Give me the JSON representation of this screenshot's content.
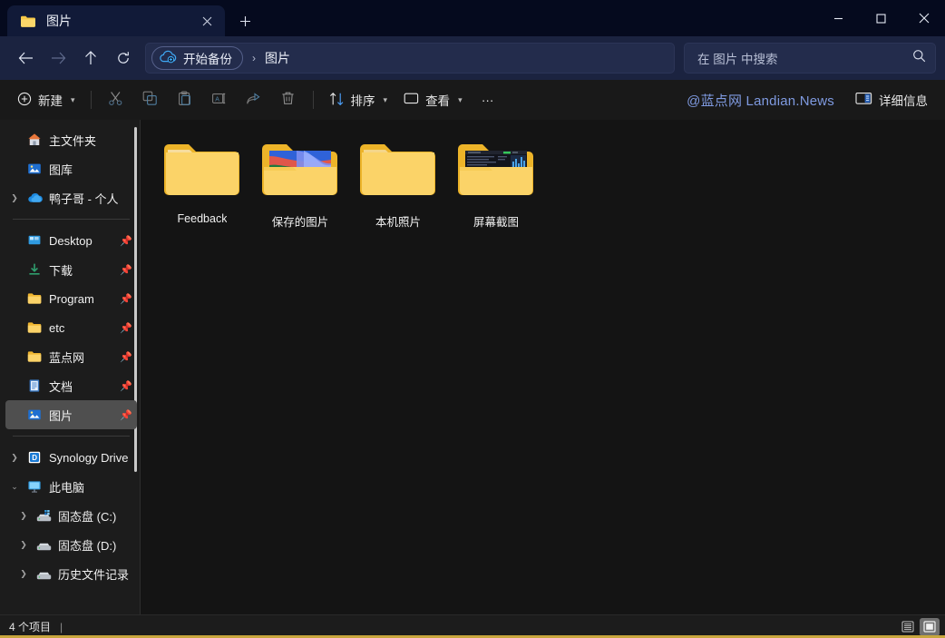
{
  "window": {
    "title": "图片",
    "controls": {
      "minimize": "minimize",
      "maximize": "maximize",
      "close": "close"
    }
  },
  "tabs": [
    {
      "title": "图片",
      "icon": "folder-icon",
      "close_label": "✕"
    }
  ],
  "newtab_label": "+",
  "address": {
    "back": "←",
    "forward": "→",
    "up": "↑",
    "refresh": "⟳",
    "backup_button": "开始备份",
    "separator": "›",
    "crumb": "图片"
  },
  "search": {
    "placeholder": "在 图片 中搜索",
    "icon": "search-icon"
  },
  "toolbar": {
    "new_label": "新建",
    "cut_label": "剪切",
    "copy_label": "复制",
    "paste_label": "粘贴",
    "rename_label": "重命名",
    "share_label": "共享",
    "delete_label": "删除",
    "sort_label": "排序",
    "view_label": "查看",
    "more_label": "···",
    "watermark": "@蓝点网 Landian.News",
    "details_label": "详细信息"
  },
  "sidebar": {
    "items": [
      {
        "label": "主文件夹",
        "icon": "home-icon",
        "chevron": false,
        "pinned": false,
        "selected": false
      },
      {
        "label": "图库",
        "icon": "gallery-icon",
        "chevron": false,
        "pinned": false,
        "selected": false
      },
      {
        "label": "鸭子哥 - 个人",
        "icon": "onedrive-icon",
        "chevron": true,
        "pinned": false,
        "selected": false
      }
    ],
    "pinned_items": [
      {
        "label": "Desktop",
        "icon": "desktop-icon",
        "chevron": false,
        "pinned": true,
        "selected": false
      },
      {
        "label": "下载",
        "icon": "downloads-icon",
        "chevron": false,
        "pinned": true,
        "selected": false
      },
      {
        "label": "Program",
        "icon": "folder-icon",
        "chevron": false,
        "pinned": true,
        "selected": false
      },
      {
        "label": "etc",
        "icon": "folder-icon",
        "chevron": false,
        "pinned": true,
        "selected": false
      },
      {
        "label": "蓝点网",
        "icon": "folder-icon",
        "chevron": false,
        "pinned": true,
        "selected": false
      },
      {
        "label": "文档",
        "icon": "documents-icon",
        "chevron": false,
        "pinned": true,
        "selected": false
      },
      {
        "label": "图片",
        "icon": "pictures-icon",
        "chevron": false,
        "pinned": true,
        "selected": true
      }
    ],
    "devices": [
      {
        "label": "Synology Drive",
        "icon": "synology-icon",
        "chevron": true,
        "pinned": false,
        "selected": false
      },
      {
        "label": "此电脑",
        "icon": "thispc-icon",
        "chevron": true,
        "expanded": true,
        "pinned": false,
        "selected": false
      }
    ],
    "drives": [
      {
        "label": "固态盘 (C:)",
        "icon": "drive-system-icon",
        "chevron": true,
        "pinned": false,
        "selected": false
      },
      {
        "label": "固态盘 (D:)",
        "icon": "drive-icon",
        "chevron": true,
        "pinned": false,
        "selected": false
      },
      {
        "label": "历史文件记录",
        "icon": "drive-icon",
        "chevron": true,
        "pinned": false,
        "selected": false
      }
    ]
  },
  "files": [
    {
      "name": "Feedback",
      "type": "folder",
      "thumb": "none"
    },
    {
      "name": "保存的图片",
      "type": "folder",
      "thumb": "colorful-wallpaper"
    },
    {
      "name": "本机照片",
      "type": "folder",
      "thumb": "none"
    },
    {
      "name": "屏幕截图",
      "type": "folder",
      "thumb": "dark-screenshot"
    }
  ],
  "status": {
    "item_count": "4 个项目",
    "separator": "|",
    "view_list": "list-view",
    "view_icons": "large-icons-view"
  },
  "colors": {
    "titlebar": "#050a1e",
    "tab_active": "#111a38",
    "addressbar": "#1b2340",
    "commandbar": "#191919",
    "sidebar": "#1c1c1c",
    "content": "#141414",
    "accent_blue": "#7f9ae0",
    "folder_yellow": "#f5c33b",
    "selection": "#4f4f4f",
    "bottom_accent": "#c8a63d"
  }
}
